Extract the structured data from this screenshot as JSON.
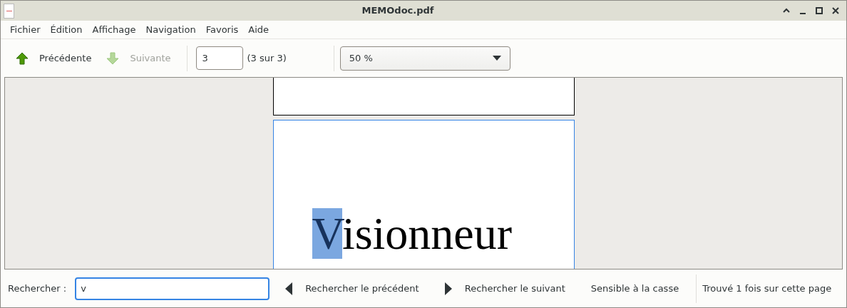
{
  "window": {
    "title": "MEMOdoc.pdf"
  },
  "menu": [
    "Fichier",
    "Édition",
    "Affichage",
    "Navigation",
    "Favoris",
    "Aide"
  ],
  "toolbar": {
    "previous": {
      "label": "Précédente",
      "disabled": false
    },
    "next": {
      "label": "Suivante",
      "disabled": true
    },
    "page_field": {
      "value": "3"
    },
    "page_count": "(3 sur 3)",
    "zoom": {
      "value": "50 %"
    }
  },
  "document": {
    "pages": [
      {
        "selected": false
      },
      {
        "selected": true,
        "segments": [
          {
            "text": "V",
            "highlighted": true
          },
          {
            "text": "isionneur",
            "highlighted": false
          }
        ]
      }
    ]
  },
  "find_bar": {
    "label": "Rechercher :",
    "value": "v",
    "previous": "Rechercher le précédent",
    "next": "Rechercher le suivant",
    "case_sensitive": {
      "label": "Sensible à la casse",
      "checked": false
    },
    "status": "Trouvé 1 fois sur cette page"
  }
}
